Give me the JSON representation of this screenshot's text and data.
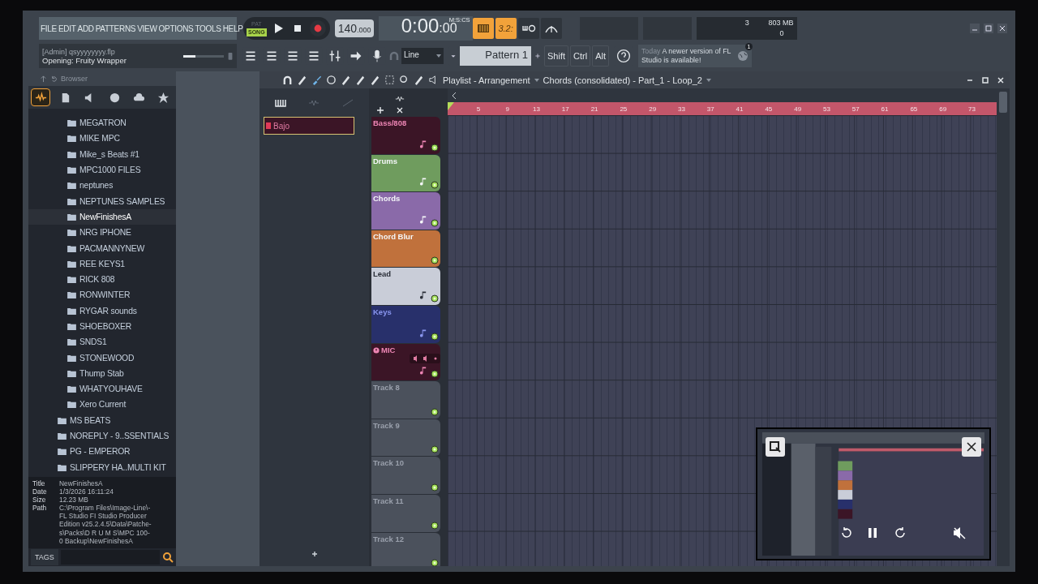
{
  "menu": [
    "FILE",
    "EDIT",
    "ADD",
    "PATTERNS",
    "VIEW",
    "OPTIONS",
    "TOOLS",
    "HELP"
  ],
  "transport": {
    "modes": [
      {
        "label": "PAT",
        "selected": false
      },
      {
        "label": "SONG",
        "selected": true
      }
    ],
    "tempo": "140",
    "tempo_decimals": ".000",
    "time": "0:00",
    "time_small": ":00",
    "time_format": "M:S:CS"
  },
  "toggles": [
    {
      "kind": "keyboard",
      "on": true
    },
    {
      "kind": "countdown",
      "label": "3.2:",
      "on": true
    },
    {
      "kind": "loop",
      "on": false
    },
    {
      "kind": "metronome",
      "on": false
    }
  ],
  "monitor": {
    "voices": "3",
    "memory": "803 MB",
    "polyphony": "0"
  },
  "hint": {
    "line1": "[Admin] qsyyyyyyyy.flp",
    "line2": "Opening: Fruity Wrapper",
    "level": 0.3
  },
  "snap": "Line",
  "pattern": "Pattern 1",
  "keys": [
    "Shift",
    "Ctrl",
    "Alt"
  ],
  "news": {
    "date": "Today",
    "text": "A newer version of FL Studio is available!",
    "badge": "1"
  },
  "browser": {
    "title": "Browser",
    "tabs": [
      {
        "kind": "all",
        "selected": true
      },
      {
        "kind": "files",
        "selected": false
      },
      {
        "kind": "speaker",
        "selected": false
      },
      {
        "kind": "globe",
        "selected": false
      },
      {
        "kind": "cloud",
        "selected": false
      },
      {
        "kind": "star",
        "selected": false
      }
    ],
    "open_folder_children": [
      {
        "label": "MEGATRON",
        "selected": false
      },
      {
        "label": "MIKE MPC",
        "selected": false
      },
      {
        "label": "Mike_s Beats #1",
        "selected": false
      },
      {
        "label": "MPC1000 FILES",
        "selected": false
      },
      {
        "label": "neptunes",
        "selected": false
      },
      {
        "label": "NEPTUNES SAMPLES",
        "selected": false
      },
      {
        "label": "NewFinishesA",
        "selected": true
      },
      {
        "label": "NRG IPHONE",
        "selected": false
      },
      {
        "label": "PACMANNYNEW",
        "selected": false
      },
      {
        "label": "REE KEYS1",
        "selected": false
      },
      {
        "label": "RICK 808",
        "selected": false
      },
      {
        "label": "RONWINTER",
        "selected": false
      },
      {
        "label": "RYGAR sounds",
        "selected": false
      },
      {
        "label": "SHOEBOXER",
        "selected": false
      },
      {
        "label": "SNDS1",
        "selected": false
      },
      {
        "label": "STONEWOOD",
        "selected": false
      },
      {
        "label": "Thump Stab",
        "selected": false
      },
      {
        "label": "WHATYOUHAVE",
        "selected": false
      },
      {
        "label": "Xero Current",
        "selected": false
      }
    ],
    "folders": [
      {
        "label": "MS BEATS",
        "selected": false
      },
      {
        "label": "NOREPLY - 9..SSENTIALS",
        "selected": false
      },
      {
        "label": "PG - EMPEROR",
        "selected": false
      },
      {
        "label": "SLIPPERY HA..MULTI KIT",
        "selected": false
      }
    ],
    "info": [
      {
        "key": "Title",
        "value": "NewFinishesA"
      },
      {
        "key": "Date",
        "value": "1/3/2026 16:11:24"
      },
      {
        "key": "Size",
        "value": "12.23 MB"
      },
      {
        "key": "Path",
        "value": "C:\\Program Files\\Image-Line\\-\nFL Studio FI Studio Producer\nEdition v25.2.4.5\\Data\\Patche-\ns\\Packs\\D R U M S\\MPC 100-\n0 Backup\\NewFinishesA"
      }
    ],
    "tags": "TAGS"
  },
  "playlist": {
    "title": "Playlist - Arrangement",
    "context": "Chords (consolidated) - Part_1 - Loop_2",
    "patterns": [
      {
        "label": "Bajo",
        "selected": true
      }
    ],
    "ruler": [
      "5",
      "9",
      "13",
      "17",
      "21",
      "25",
      "29",
      "33",
      "37",
      "41",
      "45",
      "49",
      "53",
      "57",
      "61",
      "65",
      "69",
      "73"
    ],
    "tracks": [
      {
        "name": "Bass/808",
        "color": "#3b1526",
        "kind": "instrument"
      },
      {
        "name": "Drums",
        "color": "#6f9c5e",
        "kind": "instrument"
      },
      {
        "name": "Chords",
        "color": "#8a6aa9",
        "kind": "instrument"
      },
      {
        "name": "Chord Blur",
        "color": "#c0713c",
        "kind": "audio"
      },
      {
        "name": "Lead",
        "color": "#c9cdd8",
        "kind": "instrument"
      },
      {
        "name": "Keys",
        "color": "#28306b",
        "kind": "instrument"
      },
      {
        "name": "MIC",
        "color": "#3b1526",
        "kind": "mic"
      },
      {
        "name": "Track 8",
        "color": "#4b515c",
        "kind": "empty"
      },
      {
        "name": "Track 9",
        "color": "#4b515c",
        "kind": "empty"
      },
      {
        "name": "Track 10",
        "color": "#4b515c",
        "kind": "empty"
      },
      {
        "name": "Track 11",
        "color": "#4b515c",
        "kind": "empty"
      },
      {
        "name": "Track 12",
        "color": "#4b515c",
        "kind": "empty"
      }
    ]
  },
  "video_popup": {
    "kind": "picture",
    "paused": false,
    "muted": true
  }
}
